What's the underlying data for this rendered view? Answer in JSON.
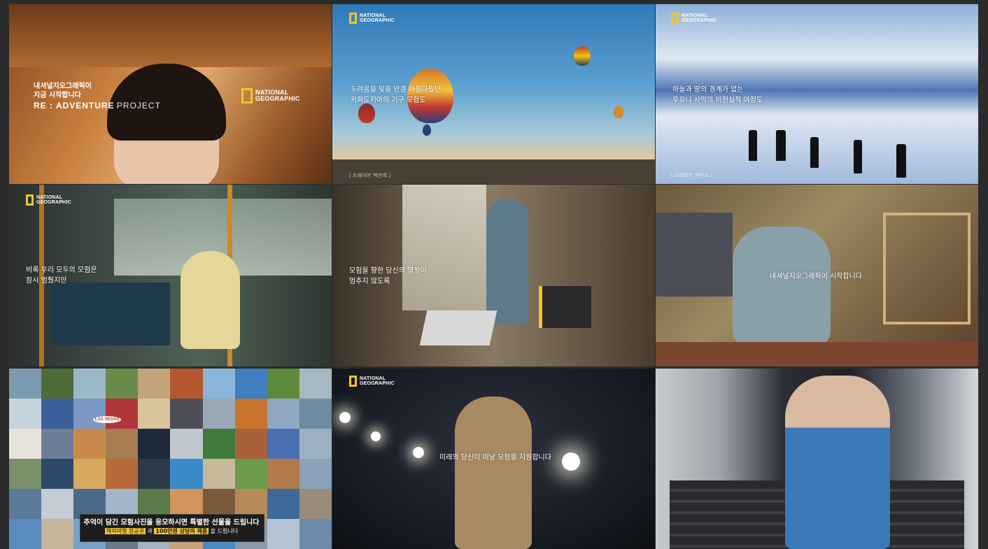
{
  "panel1": {
    "intro_line1": "내셔널지오그래픽이",
    "intro_line2": "지금 시작합니다",
    "readventure": "RE : ADVENTURE",
    "project": "PROJECT",
    "logo_line1": "NATIONAL",
    "logo_line2": "GEOGRAPHIC"
  },
  "panel2": {
    "logo_line1": "NATIONAL",
    "logo_line2": "GEOGRAPHIC",
    "caption_line1": "두려움을 잊을 만큼 아름다웠던",
    "caption_line2": "카파도키아의 기구 모험도",
    "credit": "[ 드레이어 '박은희 ]"
  },
  "panel3": {
    "logo_line1": "NATIONAL",
    "logo_line2": "GEOGRAPHIC",
    "caption_line1": "하늘과 땅의 경계가 없는",
    "caption_line2": "우유니 사막의 비현실적 여정도",
    "credit": "[ 드레이어 '박은희 ]"
  },
  "panel4": {
    "logo_line1": "NATIONAL",
    "logo_line2": "GEOGRAPHIC",
    "caption_line1": "비록 우리 모두의 모험은",
    "caption_line2": "잠시 멈췄지만"
  },
  "panel5": {
    "caption_line1": "모험을 향한 당신의 열정이",
    "caption_line2": "멈추지 않도록"
  },
  "panel6": {
    "caption": "내셔널지오그래픽이 시작합니다"
  },
  "panel7": {
    "banner_main": "추억이 담긴 모험사진을 응모하시면 특별한 선물을 드립니다",
    "banner_sub_a": "해외여행 항공권",
    "banner_sub_b": "과",
    "banner_sub_c": "100만원 상당의 제품",
    "banner_sub_d": "을 드립니다",
    "sign_text": "LAS VEGAS"
  },
  "panel8": {
    "logo_line1": "NATIONAL",
    "logo_line2": "GEOGRAPHIC",
    "caption": "미래의 당신이 떠날 모험을 지원합니다"
  },
  "colors": {
    "brand_yellow": "#f6c32b",
    "banner_bg": "#1d1d1d",
    "banner_highlight": "#f6c32b"
  }
}
